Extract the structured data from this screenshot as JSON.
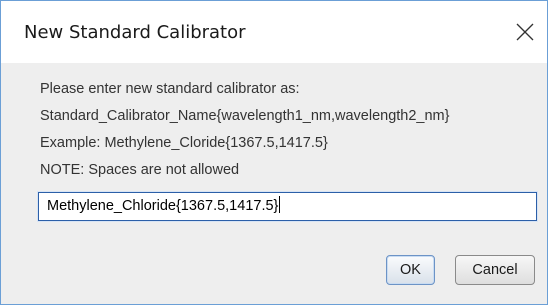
{
  "window": {
    "title": "New Standard Calibrator",
    "close_icon": "close-icon",
    "accent_color": "#2c5fa8"
  },
  "message": {
    "line1": "Please enter new standard calibrator as:",
    "line2": "Standard_Calibrator_Name{wavelength1_nm,wavelength2_nm}",
    "line3": "Example: Methylene_Cloride{1367.5,1417.5}",
    "line4": "NOTE: Spaces are not allowed"
  },
  "input": {
    "value": "Methylene_Chloride{1367.5,1417.5}"
  },
  "buttons": {
    "ok_label": "OK",
    "cancel_label": "Cancel"
  }
}
